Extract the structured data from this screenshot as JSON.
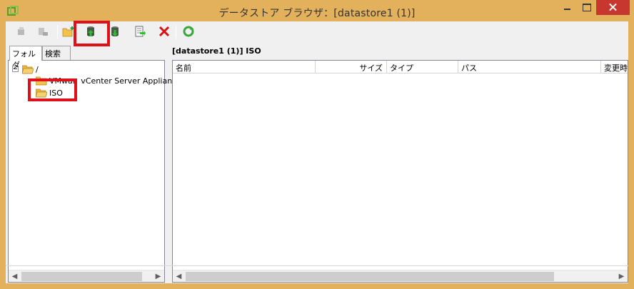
{
  "window": {
    "title": "データストア ブラウザ：[datastore1 (1)]"
  },
  "toolbar": {
    "buttons": [
      {
        "name": "back-icon",
        "enabled": false
      },
      {
        "name": "forward-icon",
        "enabled": false
      },
      {
        "name": "new-folder-icon",
        "enabled": true
      },
      {
        "name": "upload-icon",
        "enabled": true,
        "highlighted": true
      },
      {
        "name": "download-icon",
        "enabled": true
      },
      {
        "name": "register-vm-icon",
        "enabled": true
      },
      {
        "name": "delete-icon",
        "enabled": true
      },
      {
        "name": "refresh-icon",
        "enabled": true
      }
    ]
  },
  "left_pane": {
    "tabs": [
      "フォルダ",
      "検索"
    ],
    "active_tab": "フォルダ",
    "tree": {
      "root": "/",
      "children": [
        {
          "label": "VMwar",
          "label_suffix": "vCenter Server Applian"
        },
        {
          "label": "ISO",
          "highlighted": true
        }
      ]
    }
  },
  "right_pane": {
    "path": "[datastore1 (1)] ISO",
    "columns": [
      "名前",
      "サイズ",
      "タイプ",
      "パス",
      "変更時"
    ],
    "rows": []
  },
  "colors": {
    "frame": "#e3b15c",
    "close_button": "#c7372f",
    "highlight": "#e0101a",
    "folder": "#f3c24a"
  }
}
